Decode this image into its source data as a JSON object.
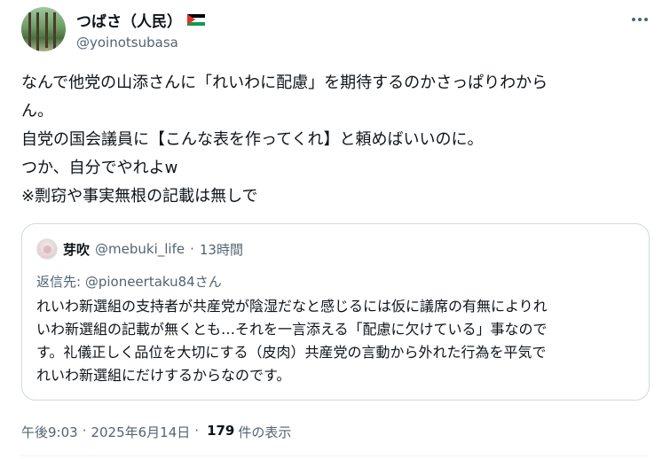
{
  "author": {
    "display_name": "つばさ（人民）",
    "handle": "@yoinotsubasa"
  },
  "tweet": {
    "lines": [
      "なんで他党の山添さんに「れいわに配慮」を期待するのかさっぱりわから",
      "ん。",
      "自党の国会議員に【こんな表を作ってくれ】と頼めばいいのに。",
      "つか、自分でやれよw",
      "※剽窃や事実無根の記載は無しで"
    ]
  },
  "quoted": {
    "display_name": "芽吹",
    "handle": "@mebuki_life",
    "dot": "·",
    "time": "13時間",
    "reply_prefix": "返信先: ",
    "reply_to": "@pioneertaku84さん",
    "lines": [
      "れいわ新選組の支持者が共産党が陰湿だなと感じるには仮に議席の有無によりれ",
      "いわ新選組の記載が無くとも…それを一言添える「配慮に欠けている」事なので",
      "す。礼儀正しく品位を大切にする（皮肉）共産党の言動から外れた行為を平気で",
      "れいわ新選組にだけするからなのです。"
    ]
  },
  "footer": {
    "time": "午後9:03",
    "sep": "·",
    "date": "2025年6月14日",
    "views_count": "179",
    "views_label": "件の表示"
  },
  "colors": {
    "text_primary": "#0f1419",
    "text_secondary": "#536471",
    "border": "#cfd9de"
  },
  "icons": {
    "more": "more-horizontal-icon",
    "flag": "palestine-flag-icon"
  }
}
